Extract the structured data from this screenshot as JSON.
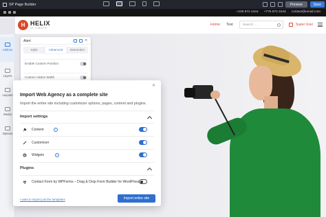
{
  "builder": {
    "title": "SP Page Builder",
    "preview_label": "Preview",
    "save_label": "Save"
  },
  "site": {
    "infobar": {
      "phone": "+228 872 4444",
      "phone2": "+775 872 4444",
      "email": "contact@email.com"
    },
    "logo": {
      "mark": "H",
      "name": "HELIX",
      "sub": "ULTIMATE"
    },
    "nav": {
      "home": "Home",
      "test": "Test"
    },
    "search_placeholder": "Search ...",
    "user": "Super User"
  },
  "rail": {
    "items": [
      {
        "label": "Addons",
        "active": true
      },
      {
        "label": "Layers",
        "active": false
      },
      {
        "label": "Layouts",
        "active": false
      },
      {
        "label": "Media",
        "active": false
      },
      {
        "label": "Options",
        "active": false
      }
    ]
  },
  "panel": {
    "title": "Alert",
    "tabs": [
      "Style",
      "Advanced",
      "Interaction"
    ],
    "active_tab": "Advanced",
    "rows": [
      "Enable Custom Position",
      "Custom Addon Width"
    ]
  },
  "modal": {
    "title": "Import Web Agency as a complete site",
    "description": "Import the entire site including customizer options, pages, content and plugins.",
    "import_settings": {
      "title": "Import settings",
      "items": [
        {
          "label": "Content",
          "icon": "pin-icon",
          "info": true,
          "enabled": true
        },
        {
          "label": "Customizer",
          "icon": "brush-icon",
          "info": false,
          "enabled": true
        },
        {
          "label": "Widgets",
          "icon": "gear-icon",
          "info": true,
          "enabled": true
        }
      ]
    },
    "plugins": {
      "title": "Plugins",
      "items": [
        {
          "label": "Contact Form by WPForms – Drag & Drop Form Builder for WordPress",
          "icon": "plug-icon",
          "enabled": false
        }
      ]
    },
    "link": "I want to import just the templates",
    "button": "Import entire site"
  },
  "colors": {
    "accent": "#2e6fd0",
    "brand": "#d9482b",
    "sweater": "#1f8a3a"
  }
}
